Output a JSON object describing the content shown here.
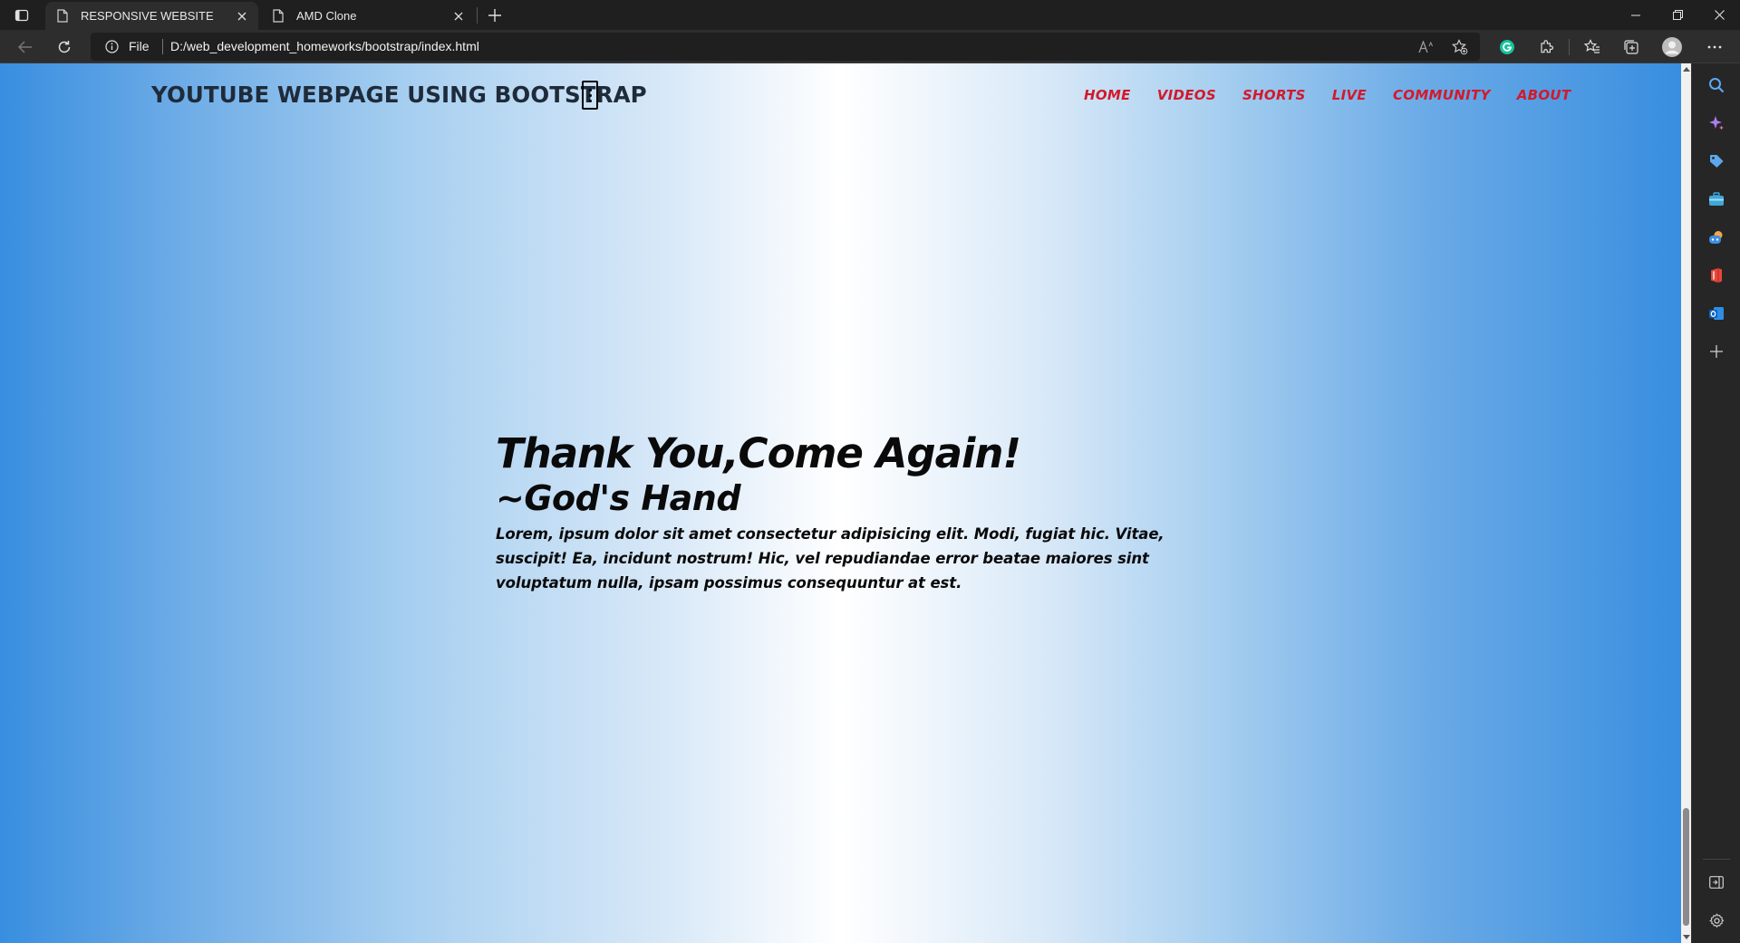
{
  "browser": {
    "tabs": [
      {
        "title": "RESPONSIVE WEBSITE",
        "active": true
      },
      {
        "title": "AMD Clone",
        "active": false
      }
    ],
    "address": {
      "scheme_label": "File",
      "url": "D:/web_development_homeworks/bootstrap/index.html"
    }
  },
  "page": {
    "brand": "YOUTUBE WEBPAGE USING BOOTSTRAP",
    "nav": [
      "HOME",
      "VIDEOS",
      "SHORTS",
      "LIVE",
      "COMMUNITY",
      "ABOUT"
    ],
    "hero": {
      "title": "Thank You,Come Again!",
      "subtitle": "~God's Hand",
      "body": "Lorem, ipsum dolor sit amet consectetur adipisicing elit. Modi, fugiat hic. Vitae, suscipit! Ea, incidunt nostrum! Hic, vel repudiandae error beatae maiores sint voluptatum nulla, ipsam possimus consequuntur at est."
    }
  },
  "colors": {
    "nav_link": "#d3192b",
    "gradient_edge": "#388ee0",
    "gradient_center": "#ffffff",
    "brand_text": "#1f2b3a"
  }
}
